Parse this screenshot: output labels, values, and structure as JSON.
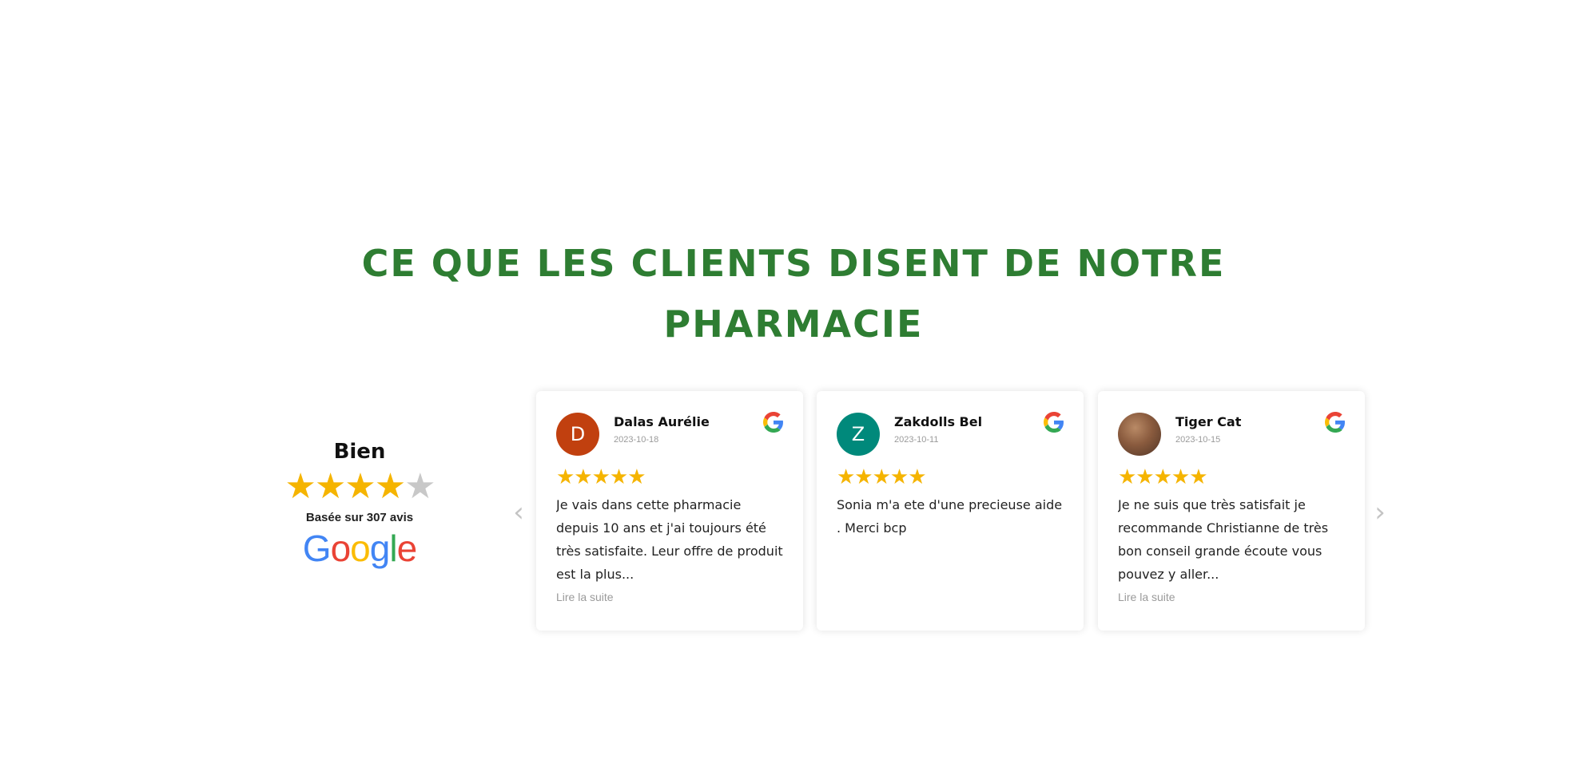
{
  "heading": {
    "line1": "CE QUE LES CLIENTS DISENT DE NOTRE",
    "line2": "PHARMACIE"
  },
  "summary": {
    "rating_label": "Bien",
    "stars_filled": 4,
    "stars_total": 5,
    "count_text": "Basée sur 307 avis",
    "provider": "Google"
  },
  "colors": {
    "heading": "#2e7d32",
    "star": "#f5b400",
    "star_empty": "#c8c8c8"
  },
  "navigation": {
    "prev_icon": "chevron-left-icon",
    "next_icon": "chevron-right-icon"
  },
  "reviews": [
    {
      "initial": "D",
      "avatar_color": "#c1400f",
      "name": "Dalas Aurélie",
      "date": "2023-10-18",
      "stars": 5,
      "text": "Je vais dans cette pharmacie depuis 10 ans et j'ai toujours été très satisfaite. Leur offre de produit est la plus...",
      "read_more": "Lire la suite"
    },
    {
      "initial": "Z",
      "avatar_color": "#00897b",
      "name": "Zakdolls Bel",
      "date": "2023-10-11",
      "stars": 5,
      "text": "Sonia m'a ete d'une precieuse aide . Merci bcp",
      "read_more": ""
    },
    {
      "initial": "",
      "avatar_color": "#8a5b3e",
      "name": "Tiger Cat",
      "date": "2023-10-15",
      "stars": 5,
      "text": "Je ne suis que très satisfait je recommande Christianne de très bon conseil grande écoute vous pouvez y aller...",
      "read_more": "Lire la suite"
    }
  ]
}
